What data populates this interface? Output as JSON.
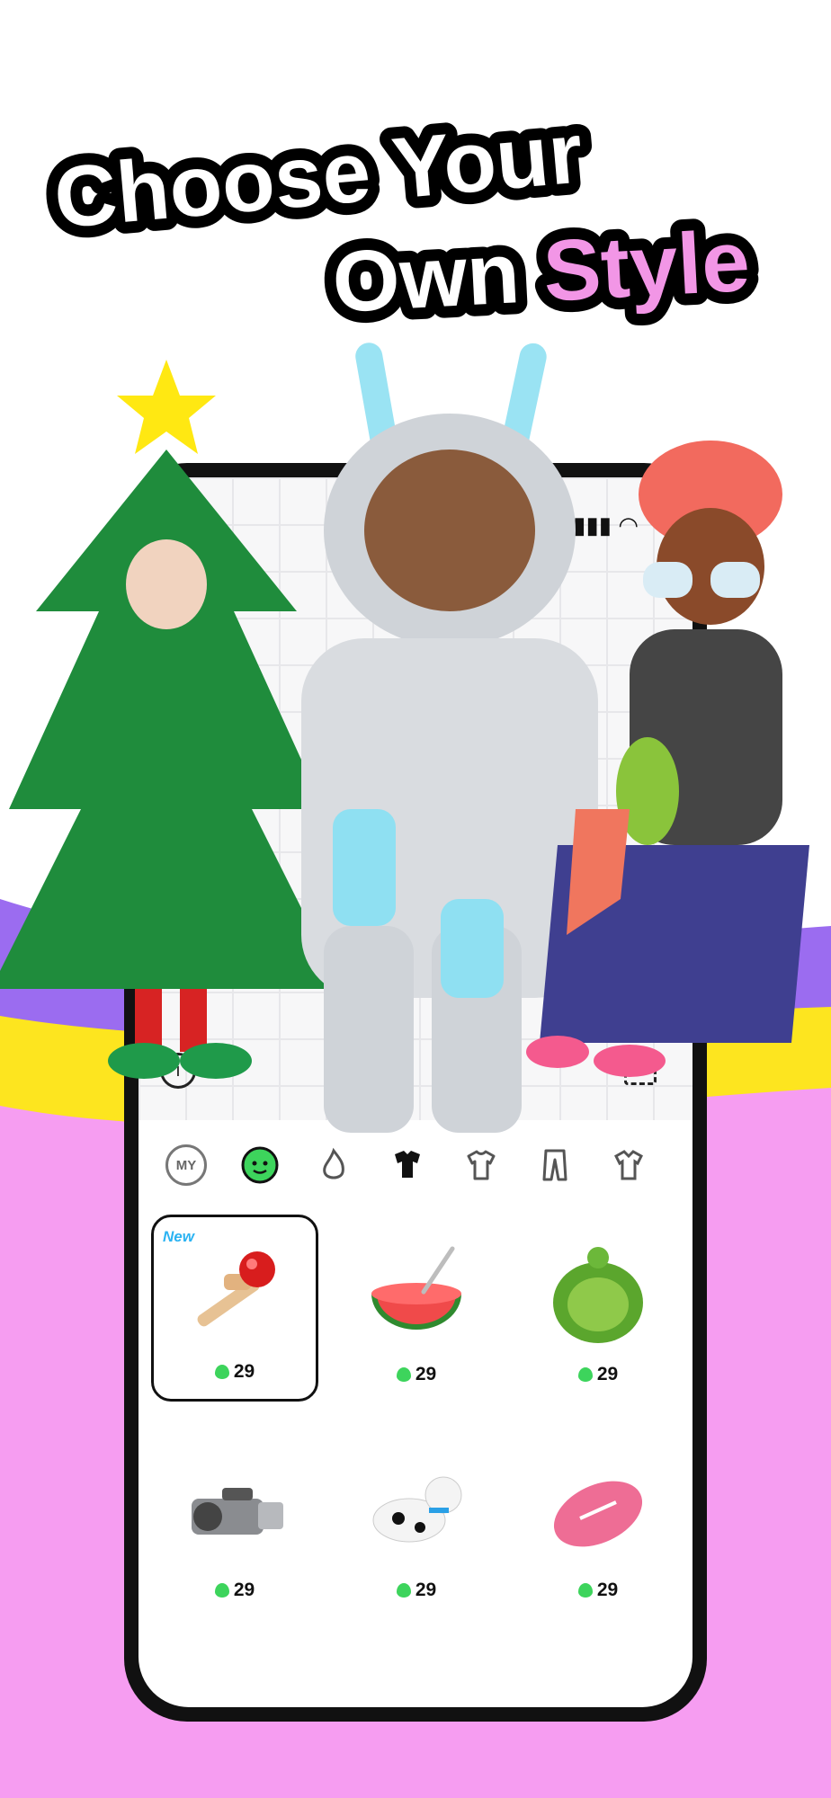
{
  "headline": {
    "line1": "Choose Your",
    "line2_prefix": "Own ",
    "line2_highlight": "Style"
  },
  "colors": {
    "highlight": "#f296e6",
    "purple_wave": "#9b6cf0",
    "yellow_wave": "#fde51f",
    "pink_wave": "#f69df1",
    "gem_green": "#3dd45c",
    "new_badge": "#2bb3f2"
  },
  "status_bar": {
    "icons": [
      "signal-icon",
      "wifi-icon"
    ]
  },
  "tabs": [
    {
      "name": "tab-my",
      "label": "MY"
    },
    {
      "name": "tab-face",
      "icon": "face-icon",
      "selected": true
    },
    {
      "name": "tab-trending",
      "icon": "flame-icon"
    },
    {
      "name": "tab-outfits",
      "icon": "outfit-icon"
    },
    {
      "name": "tab-tops",
      "icon": "tshirt-icon"
    },
    {
      "name": "tab-bottoms",
      "icon": "pants-icon"
    },
    {
      "name": "tab-more",
      "icon": "shirt-icon"
    }
  ],
  "items": [
    {
      "name": "kendama",
      "price": "29",
      "badge": "New",
      "selected": true
    },
    {
      "name": "watermelon",
      "price": "29"
    },
    {
      "name": "turtle-shell",
      "price": "29"
    },
    {
      "name": "camcorder",
      "price": "29"
    },
    {
      "name": "dalmatian-dog",
      "price": "29"
    },
    {
      "name": "football",
      "price": "29"
    }
  ]
}
